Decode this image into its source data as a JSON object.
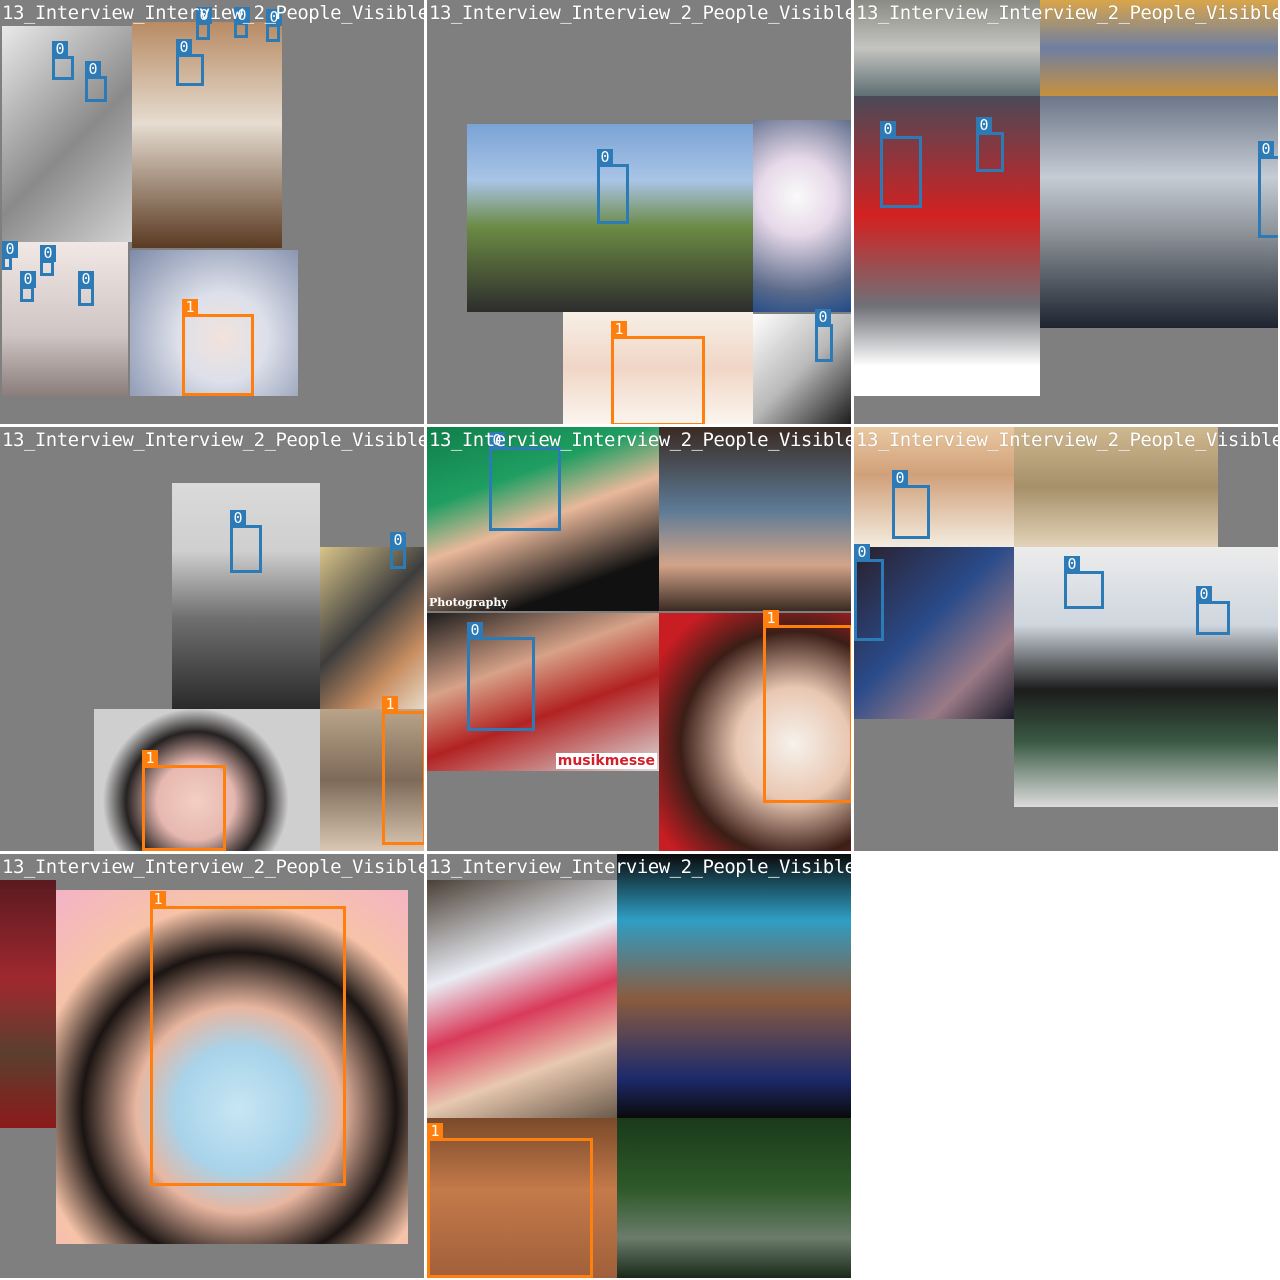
{
  "title": "13_Interview_Interview_2_People_Visible_",
  "colors": {
    "background": "#7f7f7f",
    "class_0": "#2c7bb6",
    "class_1": "#ff7f0e",
    "title_text": "#ffffff"
  },
  "tiles": [
    {
      "title": "13_Interview_Interview_2_People_Visible_"
    },
    {
      "title": "13_Interview_Interview_2_People_Visible_"
    },
    {
      "title": "13_Interview_Interview_2_People_Visible_"
    },
    {
      "title": "13_Interview_Interview_2_People_Visible_"
    },
    {
      "title": "13_Interview_Interview_2_People_Visible_"
    },
    {
      "title": "13_Interview_Interview_2_People_Visible_"
    },
    {
      "title": "13_Interview_Interview_2_People_Visible_"
    },
    {
      "title": "13_Interview_Interview_2_People_Visible"
    }
  ],
  "labels": {
    "class_0": "0",
    "class_1": "1"
  },
  "watermarks": {
    "photography": "Photography",
    "musikmesse": "musikmesse"
  }
}
